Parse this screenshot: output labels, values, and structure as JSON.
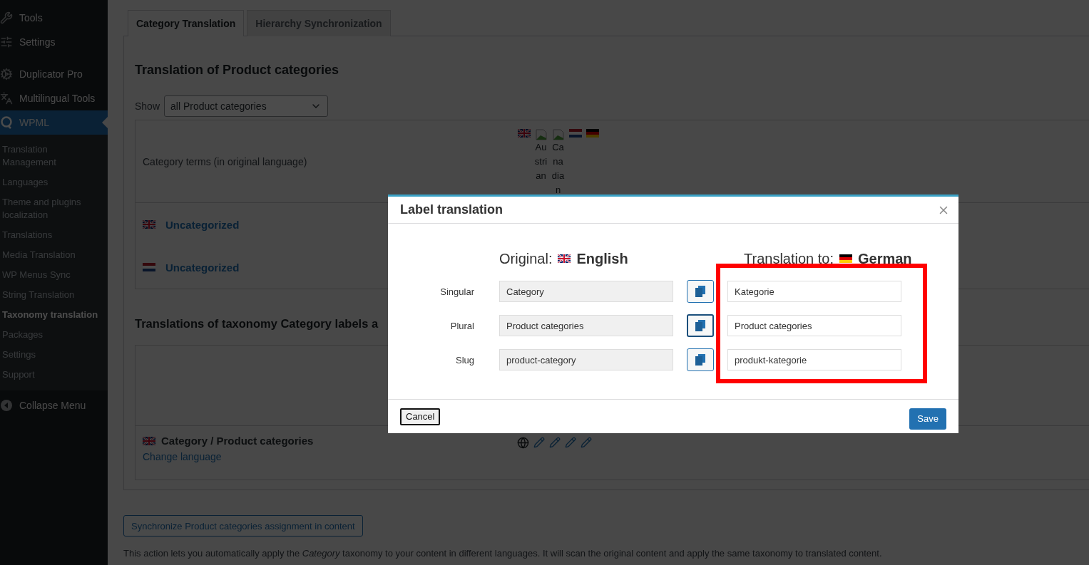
{
  "sidebar": {
    "items": [
      {
        "label": "Tools",
        "selected": false
      },
      {
        "label": "Settings",
        "selected": false
      },
      {
        "label": "Duplicator Pro",
        "selected": false
      },
      {
        "label": "Multilingual Tools",
        "selected": false
      },
      {
        "label": "WPML",
        "selected": true
      }
    ],
    "submenu": [
      {
        "label": "Translation Management",
        "selected": false
      },
      {
        "label": "Languages",
        "selected": false
      },
      {
        "label": "Theme and plugins localization",
        "selected": false
      },
      {
        "label": "Translations",
        "selected": false
      },
      {
        "label": "Media Translation",
        "selected": false
      },
      {
        "label": "WP Menus Sync",
        "selected": false
      },
      {
        "label": "String Translation",
        "selected": false
      },
      {
        "label": "Taxonomy translation",
        "selected": true
      },
      {
        "label": "Packages",
        "selected": false
      },
      {
        "label": "Settings",
        "selected": false
      },
      {
        "label": "Support",
        "selected": false
      }
    ],
    "collapse": "Collapse Menu"
  },
  "tabs": [
    {
      "label": "Category Translation",
      "selected": true
    },
    {
      "label": "Hierarchy Synchronization",
      "selected": false
    }
  ],
  "terms_section": {
    "heading": "Translation of Product categories",
    "show_label": "Show",
    "show_select": "all Product categories",
    "header": "Category terms (in original language)",
    "languages": [
      {
        "kind": "flag"
      },
      {
        "kind": "broken_image",
        "alt": "Austrian"
      },
      {
        "kind": "broken_image",
        "alt": "Canadian"
      },
      {
        "kind": "flag"
      },
      {
        "kind": "flag"
      }
    ],
    "rows": [
      {
        "name": "Uncategorized"
      },
      {
        "name": "Uncategorized"
      }
    ]
  },
  "labels_section": {
    "heading": "Translations of taxonomy Category labels a",
    "row": {
      "title": "Category / Product categories",
      "link": "Change language",
      "actions": [
        {
          "kind": "globe"
        },
        {
          "kind": "pencil"
        },
        {
          "kind": "pencil"
        },
        {
          "kind": "pencil"
        },
        {
          "kind": "pencil"
        }
      ]
    }
  },
  "sync_button": "Synchronize Product categories assignment in content",
  "note": "This action lets you automatically apply the *Category* taxonomy to your content in different languages. It will scan the original content and apply the same taxonomy to translated content.",
  "dialog": {
    "title": "Label translation",
    "original": {
      "prefix": "Original:",
      "language": "English"
    },
    "translation": {
      "prefix": "Translation to:",
      "language": "German"
    },
    "rows": [
      {
        "label": "Singular",
        "original": "Category",
        "translation": "Kategorie",
        "focused": false
      },
      {
        "label": "Plural",
        "original": "Product categories",
        "translation": "Product categories",
        "focused": true
      },
      {
        "label": "Slug",
        "original": "product-category",
        "translation": "produkt-kategorie",
        "focused": false
      }
    ],
    "cancel": {
      "label": "Cancel",
      "focused": true
    },
    "save": "Save",
    "highlight": true
  }
}
